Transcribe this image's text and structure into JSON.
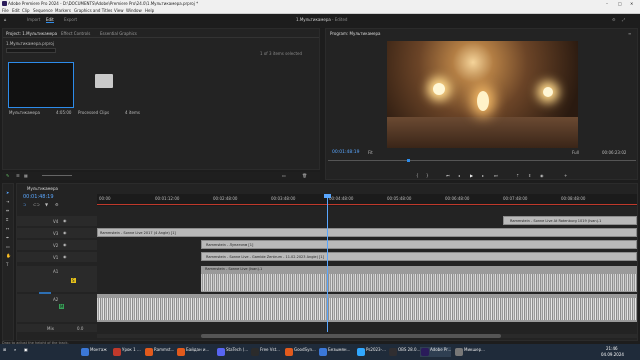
{
  "window": {
    "title": "Adobe Premiere Pro 2024 - D:\\DOCUMENTS\\Adobe\\Premiere Pro\\24.0\\1.Мультикамера.prproj *"
  },
  "menu": [
    "File",
    "Edit",
    "Clip",
    "Sequence",
    "Markers",
    "Graphics and Titles",
    "View",
    "Window",
    "Help"
  ],
  "workspace": {
    "home": "Home",
    "import": "Import",
    "edit": "Edit",
    "export": "Export",
    "sequence_title": "1.Мультикамера",
    "edited": "- Edited"
  },
  "project": {
    "tabs": [
      "Project: 1.Мультикамера",
      "Effect Controls",
      "Essential Graphics"
    ],
    "file": "1.Мультикамера.prproj",
    "count": "1 of 3 items selected",
    "items": [
      {
        "name": "Мультикамера",
        "duration": "4:05:00"
      },
      {
        "name": "Processed Clips",
        "meta": "4 items"
      }
    ]
  },
  "program": {
    "title": "Program: Мультикамера",
    "timecode": "00:01:48:19",
    "fit": "Fit",
    "full": "Full",
    "duration": "00:06:23:02"
  },
  "timeline": {
    "tab": "Мультикамера",
    "timecode": "00:01:48:19",
    "ruler": [
      "00:00",
      "00:01:12:00",
      "00:02:48:00",
      "00:03:48:00",
      "00:04:48:00",
      "00:05:48:00",
      "00:06:48:00",
      "00:07:48:00",
      "00:08:48:00",
      "00:09:48:00"
    ],
    "tracks": [
      {
        "name": "V4",
        "clip": "Rammstein - Sonne Live At Rotenburg 1019 (Ivan).1"
      },
      {
        "name": "V3",
        "clip": "Rammstein - Sonne Live 2017 (4 Angle) [1]"
      },
      {
        "name": "V2",
        "clip": "Rammstein - Лунатизм [1]"
      },
      {
        "name": "V1",
        "clip": "Rammstein - Sonne Live - Gamble Zentrum - 11.02.2023 Angle) [1]"
      },
      {
        "name": "A1",
        "clip": "Rammstein - Sonne Live (Ivan).1"
      },
      {
        "name": "A2",
        "clip": ""
      },
      {
        "name": "A3",
        "clip": ""
      },
      {
        "name": "Mix",
        "clip": ""
      }
    ],
    "mix_value": "0.0"
  },
  "status": "Drag to adjust the height of the track.",
  "taskbar": [
    {
      "label": "Монтаж",
      "color": "#3b78d8"
    },
    {
      "label": "Урок 1 ...",
      "color": "#c0392b"
    },
    {
      "label": "Rammst...",
      "color": "#e25a1c"
    },
    {
      "label": "Байдан и...",
      "color": "#e25a1c"
    },
    {
      "label": "StaTech (...",
      "color": "#5865f2"
    },
    {
      "label": "Free Vst...",
      "color": "#2b2b2b"
    },
    {
      "label": "GoodSyn...",
      "color": "#e25a1c"
    },
    {
      "label": "Безымян...",
      "color": "#3b78d8"
    },
    {
      "label": "Ps2023-...",
      "color": "#31a8ff"
    },
    {
      "label": "OBS 28.0...",
      "color": "#302e31"
    },
    {
      "label": "Adobe Pr...",
      "color": "#2a1b5a"
    },
    {
      "label": "Микшер...",
      "color": "#777"
    }
  ],
  "tray": {
    "time": "21:46",
    "date": "04.09.2024"
  }
}
